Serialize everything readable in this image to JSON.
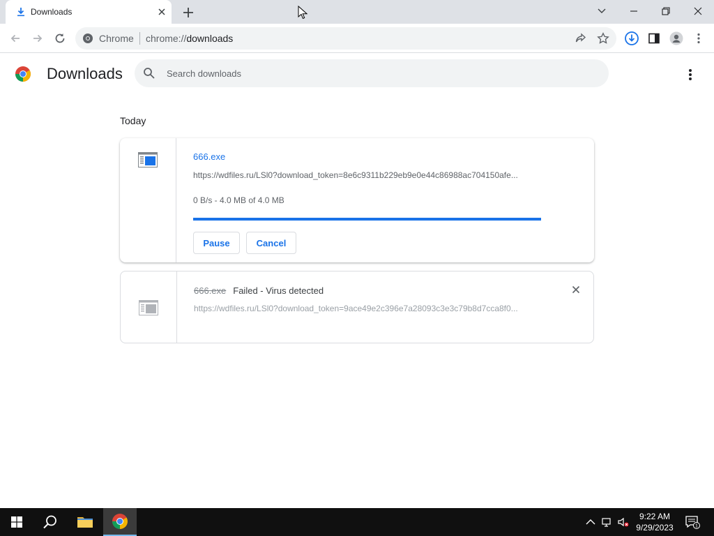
{
  "tab": {
    "title": "Downloads"
  },
  "omnibox": {
    "site_label": "Chrome",
    "url_scheme": "chrome://",
    "url_path": "downloads"
  },
  "page": {
    "title": "Downloads",
    "search_placeholder": "Search downloads",
    "date_group": "Today"
  },
  "downloads": [
    {
      "file_name": "666.exe",
      "url": "https://wdfiles.ru/LSl0?download_token=8e6c9311b229eb9e0e44c86988ac704150afe...",
      "status": "0 B/s - 4.0 MB of 4.0 MB",
      "progress_fraction": 1.0,
      "pause_label": "Pause",
      "cancel_label": "Cancel"
    },
    {
      "file_name": "666.exe",
      "status": "Failed - Virus detected",
      "url": "https://wdfiles.ru/LSl0?download_token=9ace49e2c396e7a28093c3e3c79b8d7cca8f0..."
    }
  ],
  "taskbar": {
    "time": "9:22 AM",
    "date": "9/29/2023",
    "notification_count": "1"
  },
  "colors": {
    "accent": "#1a73e8",
    "tabstrip": "#dee1e6",
    "taskbar": "#101010"
  }
}
